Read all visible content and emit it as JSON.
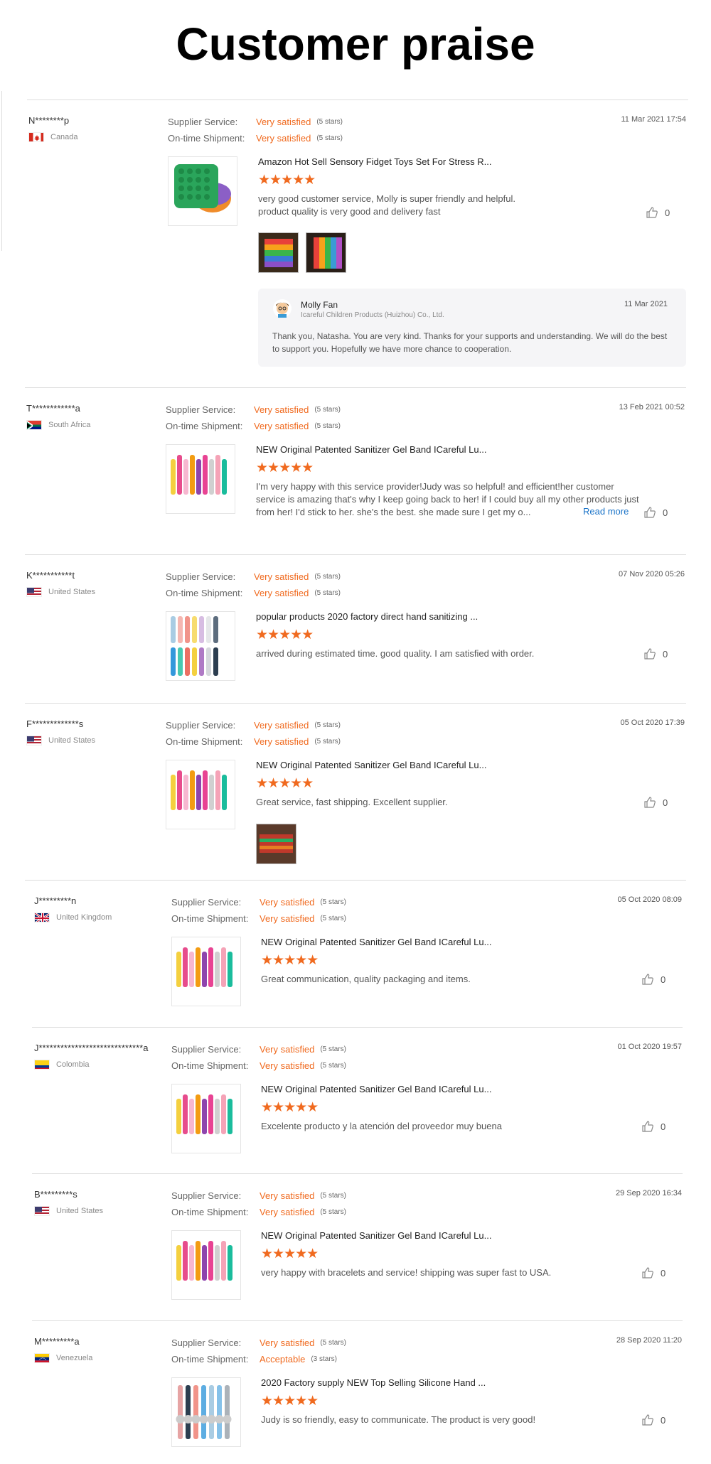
{
  "page_title": "Customer praise",
  "labels": {
    "supplier_service": "Supplier Service:",
    "ontime_shipment": "On-time Shipment:",
    "read_more": "Read more"
  },
  "colors": {
    "accent": "#f06a1f",
    "link": "#1a73c8"
  },
  "reviews": [
    {
      "name": "N********p",
      "country": "Canada",
      "flag": "flag-canada-icon",
      "date": "11 Mar 2021 17:54",
      "supplier": "Very satisfied",
      "supplier_stars": "(5 stars)",
      "shipment": "Very satisfied",
      "shipment_stars": "(5 stars)",
      "product": "Amazon Hot Sell Sensory Fidget Toys Set For Stress R...",
      "rating": "★★★★★",
      "text": "very good customer service, Molly is super friendly and helpful. product quality is very good and delivery fast",
      "likes": "0",
      "reply": {
        "name": "Molly Fan",
        "company": "Icareful Children Products (Huizhou) Co., Ltd.",
        "date": "11 Mar 2021",
        "text": "Thank you, Natasha. You are very kind. Thanks for your supports and understanding. We will do the best to support you. Hopefully we have more chance to cooperation."
      }
    },
    {
      "name": "T************a",
      "country": "South Africa",
      "flag": "flag-south-africa-icon",
      "date": "13 Feb 2021 00:52",
      "supplier": "Very satisfied",
      "supplier_stars": "(5 stars)",
      "shipment": "Very satisfied",
      "shipment_stars": "(5 stars)",
      "product": "NEW Original Patented Sanitizer Gel Band ICareful Lu...",
      "rating": "★★★★★",
      "text": "I'm very happy with this service provider!Judy was so helpful! and efficient!her customer service is amazing that's why I keep going back to her! if I could buy all my other products just from her! I'd stick to her. she's the best. she made sure I get my o...",
      "likes": "0"
    },
    {
      "name": "K***********t",
      "country": "United States",
      "flag": "flag-us-icon",
      "date": "07 Nov 2020 05:26",
      "supplier": "Very satisfied",
      "supplier_stars": "(5 stars)",
      "shipment": "Very satisfied",
      "shipment_stars": "(5 stars)",
      "product": "popular products 2020 factory direct hand sanitizing ...",
      "rating": "★★★★★",
      "text": "arrived during estimated time. good quality. I am satisfied with order.",
      "likes": "0"
    },
    {
      "name": "F*************s",
      "country": "United States",
      "flag": "flag-us-icon",
      "date": "05 Oct 2020 17:39",
      "supplier": "Very satisfied",
      "supplier_stars": "(5 stars)",
      "shipment": "Very satisfied",
      "shipment_stars": "(5 stars)",
      "product": "NEW Original Patented Sanitizer Gel Band ICareful Lu...",
      "rating": "★★★★★",
      "text": "Great service, fast shipping.  Excellent supplier.",
      "likes": "0"
    },
    {
      "name": "J*********n",
      "country": "United Kingdom",
      "flag": "flag-uk-icon",
      "date": "05 Oct 2020 08:09",
      "supplier": "Very satisfied",
      "supplier_stars": "(5 stars)",
      "shipment": "Very satisfied",
      "shipment_stars": "(5 stars)",
      "product": "NEW Original Patented Sanitizer Gel Band ICareful Lu...",
      "rating": "★★★★★",
      "text": "Great communication, quality packaging and items.",
      "likes": "0"
    },
    {
      "name": "J*****************************a",
      "country": "Colombia",
      "flag": "flag-colombia-icon",
      "date": "01 Oct 2020 19:57",
      "supplier": "Very satisfied",
      "supplier_stars": "(5 stars)",
      "shipment": "Very satisfied",
      "shipment_stars": "(5 stars)",
      "product": "NEW Original Patented Sanitizer Gel Band ICareful Lu...",
      "rating": "★★★★★",
      "text": "Excelente producto y la atención del proveedor muy buena",
      "likes": "0"
    },
    {
      "name": "B*********s",
      "country": "United States",
      "flag": "flag-us-icon",
      "date": "29 Sep 2020 16:34",
      "supplier": "Very satisfied",
      "supplier_stars": "(5 stars)",
      "shipment": "Very satisfied",
      "shipment_stars": "(5 stars)",
      "product": "NEW Original Patented Sanitizer Gel Band ICareful Lu...",
      "rating": "★★★★★",
      "text": "very happy with bracelets and service! shipping was super fast to USA.",
      "likes": "0"
    },
    {
      "name": "M*********a",
      "country": "Venezuela",
      "flag": "flag-venezuela-icon",
      "date": "28 Sep 2020 11:20",
      "supplier": "Very satisfied",
      "supplier_stars": "(5 stars)",
      "shipment": "Acceptable",
      "shipment_stars": "(3 stars)",
      "product": "2020 Factory supply NEW Top Selling Silicone Hand ...",
      "rating": "★★★★★",
      "text": "Judy is so friendly, easy to communicate. The product is very good!",
      "likes": "0"
    }
  ]
}
